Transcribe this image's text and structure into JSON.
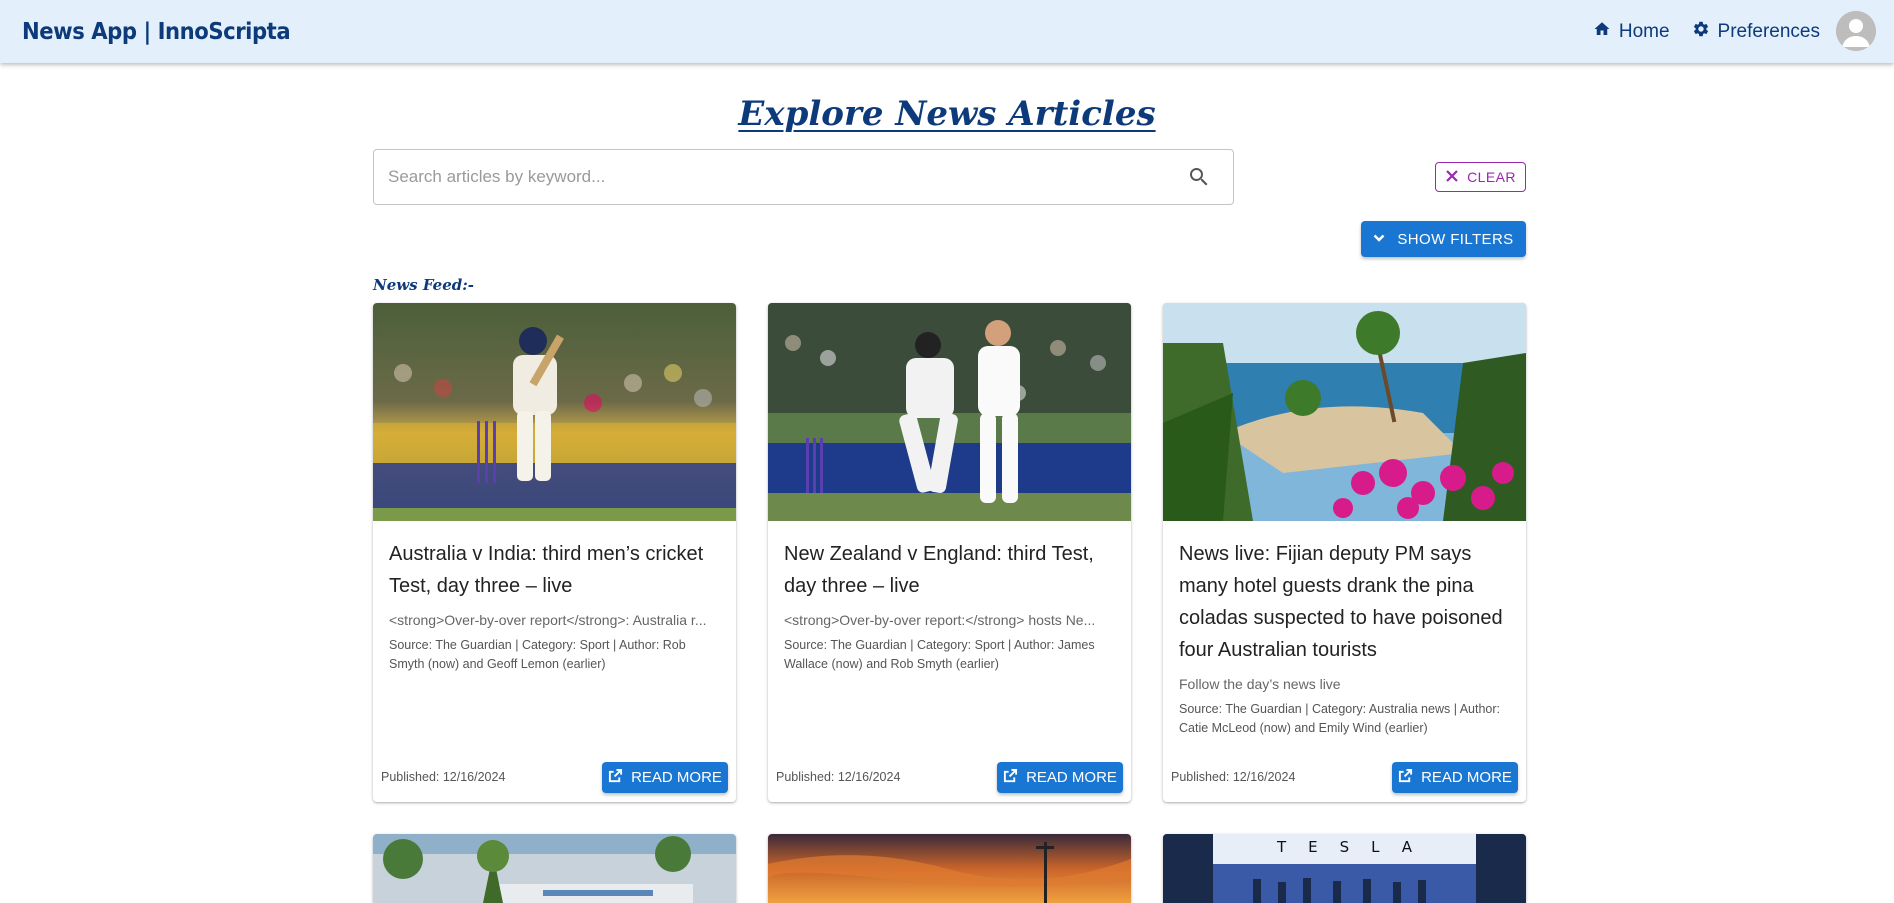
{
  "header": {
    "brand": "News App | InnoScripta",
    "nav": [
      {
        "label": "Home",
        "icon": "home-icon"
      },
      {
        "label": "Preferences",
        "icon": "gear-icon"
      }
    ],
    "avatar_icon": "user-avatar-icon"
  },
  "page_title": "Explore News Articles",
  "search": {
    "placeholder": "Search articles by keyword...",
    "value": ""
  },
  "clear_label": "CLEAR",
  "filters_label": "SHOW FILTERS",
  "feed_label": "News Feed:-",
  "colors": {
    "primary": "#1976d2",
    "brand": "#0d3a7a",
    "clear": "#9c27b0",
    "appbar": "#e3f0fc"
  },
  "articles": [
    {
      "title": "Australia v India: third men’s cricket Test, day three – live",
      "description": "<strong>Over-by-over report</strong>: Australia r...",
      "meta": "Source: The Guardian | Category: Sport | Author: Rob Smyth (now) and Geoff Lemon (earlier)",
      "published": "Published: 12/16/2024",
      "read_more": "READ MORE"
    },
    {
      "title": "New Zealand v England: third Test, day three – live",
      "description": "<strong>Over-by-over report:</strong> hosts Ne...",
      "meta": "Source: The Guardian | Category: Sport | Author: James Wallace (now) and Rob Smyth (earlier)",
      "published": "Published: 12/16/2024",
      "read_more": "READ MORE"
    },
    {
      "title": "News live: Fijian deputy PM says many hotel guests drank the pina coladas suspected to have poisoned four Australian tourists",
      "description": "Follow the day’s news live",
      "meta": "Source: The Guardian | Category: Australia news | Author: Catie McLeod (now) and Emily Wind (earlier)",
      "published": "Published: 12/16/2024",
      "read_more": "READ MORE"
    }
  ],
  "second_row_text": [
    "TESLA"
  ]
}
